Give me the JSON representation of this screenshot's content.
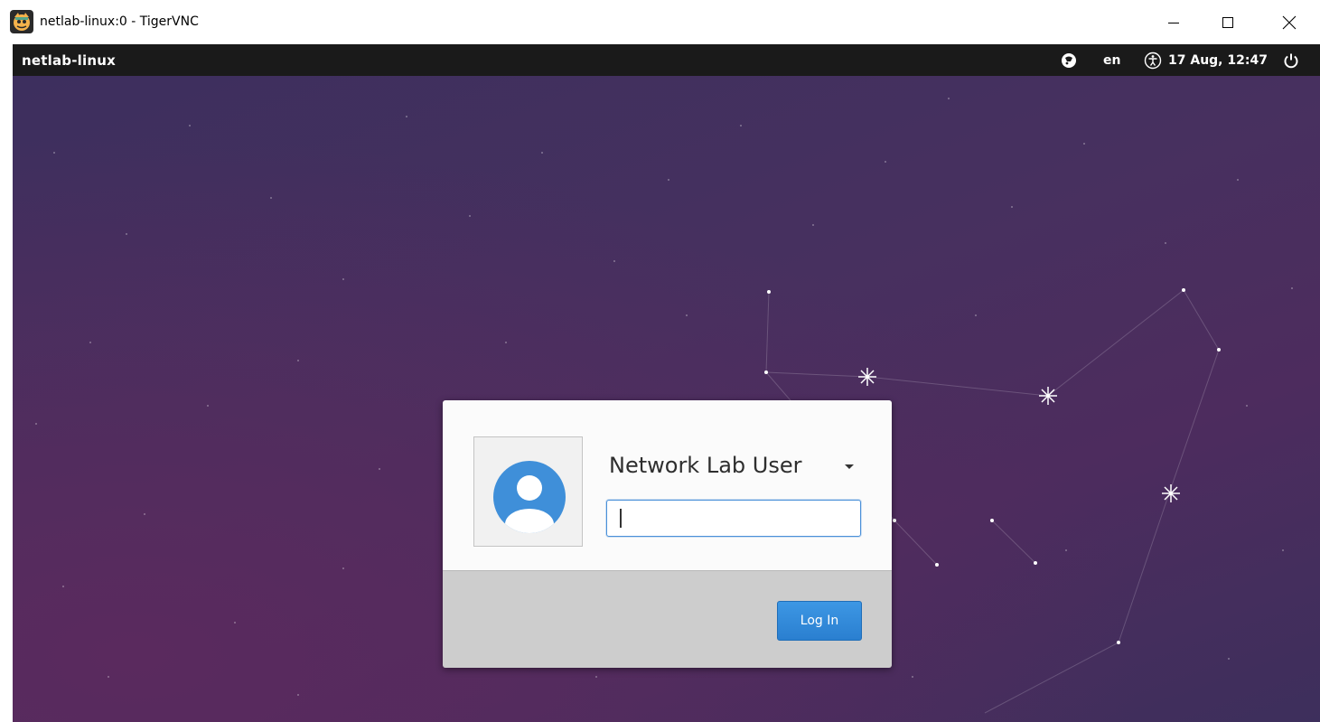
{
  "window": {
    "title": "netlab-linux:0 - TigerVNC",
    "app_icon": "tigervnc-icon",
    "controls": {
      "minimize": "–",
      "maximize": "☐",
      "close": "✕"
    }
  },
  "panel": {
    "hostname": "netlab-linux",
    "indicators": {
      "session_icon": "session-icon",
      "keyboard_layout": "en",
      "accessibility_icon": "accessibility-icon",
      "datetime": "17 Aug, 12:47",
      "power_icon": "power-icon"
    }
  },
  "login": {
    "username": "Network Lab User",
    "password_value": "",
    "login_button": "Log In",
    "avatar_icon": "user-avatar-icon"
  },
  "colors": {
    "accent": "#2a7fd0",
    "panel_bg": "#1a1a1a",
    "desktop_bg": "#45305e"
  }
}
